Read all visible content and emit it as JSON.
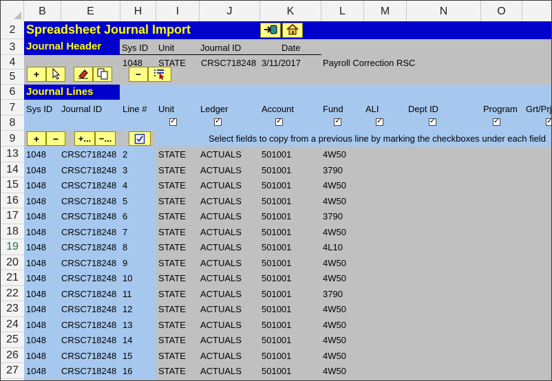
{
  "columns": [
    "B",
    "E",
    "H",
    "I",
    "J",
    "K",
    "L",
    "M",
    "N",
    "O"
  ],
  "title": "Spreadsheet Journal Import",
  "header": {
    "section_label": "Journal Header",
    "col_labels": {
      "sys_id": "Sys ID",
      "unit": "Unit",
      "journal_id": "Journal ID",
      "date": "Date"
    },
    "values": {
      "sys_id": "1048",
      "unit": "STATE",
      "journal_id": "CRSC718248",
      "date": "3/11/2017",
      "description": "Payroll Correction RSC"
    }
  },
  "lines_label": "Journal Lines",
  "line_cols": {
    "sys_id": "Sys ID",
    "journal_id": "Journal ID",
    "line": "Line #",
    "unit": "Unit",
    "ledger": "Ledger",
    "account": "Account",
    "fund": "Fund",
    "ali": "ALI",
    "dept": "Dept ID",
    "program": "Program",
    "grt": "Grt/Prj"
  },
  "select_hint": "Select fields to copy from a previous line by marking the checkboxes under each field",
  "row_numbers": {
    "title": "2",
    "hdr": "3",
    "hdrvals": "4",
    "tools": "5",
    "lines": "6",
    "linecols": "7",
    "checks": "8",
    "linetools": "9"
  },
  "lines": [
    {
      "row": "13",
      "sys": "1048",
      "jid": "CRSC718248",
      "line": "2",
      "unit": "STATE",
      "ledger": "ACTUALS",
      "account": "501001",
      "fund": "4W50"
    },
    {
      "row": "14",
      "sys": "1048",
      "jid": "CRSC718248",
      "line": "3",
      "unit": "STATE",
      "ledger": "ACTUALS",
      "account": "501001",
      "fund": "3790"
    },
    {
      "row": "15",
      "sys": "1048",
      "jid": "CRSC718248",
      "line": "4",
      "unit": "STATE",
      "ledger": "ACTUALS",
      "account": "501001",
      "fund": "4W50"
    },
    {
      "row": "16",
      "sys": "1048",
      "jid": "CRSC718248",
      "line": "5",
      "unit": "STATE",
      "ledger": "ACTUALS",
      "account": "501001",
      "fund": "4W50"
    },
    {
      "row": "17",
      "sys": "1048",
      "jid": "CRSC718248",
      "line": "6",
      "unit": "STATE",
      "ledger": "ACTUALS",
      "account": "501001",
      "fund": "3790"
    },
    {
      "row": "18",
      "sys": "1048",
      "jid": "CRSC718248",
      "line": "7",
      "unit": "STATE",
      "ledger": "ACTUALS",
      "account": "501001",
      "fund": "4W50"
    },
    {
      "row": "19",
      "sys": "1048",
      "jid": "CRSC718248",
      "line": "8",
      "unit": "STATE",
      "ledger": "ACTUALS",
      "account": "501001",
      "fund": "4L10"
    },
    {
      "row": "20",
      "sys": "1048",
      "jid": "CRSC718248",
      "line": "9",
      "unit": "STATE",
      "ledger": "ACTUALS",
      "account": "501001",
      "fund": "4W50"
    },
    {
      "row": "21",
      "sys": "1048",
      "jid": "CRSC718248",
      "line": "10",
      "unit": "STATE",
      "ledger": "ACTUALS",
      "account": "501001",
      "fund": "4W50"
    },
    {
      "row": "22",
      "sys": "1048",
      "jid": "CRSC718248",
      "line": "11",
      "unit": "STATE",
      "ledger": "ACTUALS",
      "account": "501001",
      "fund": "3790"
    },
    {
      "row": "23",
      "sys": "1048",
      "jid": "CRSC718248",
      "line": "12",
      "unit": "STATE",
      "ledger": "ACTUALS",
      "account": "501001",
      "fund": "4W50"
    },
    {
      "row": "24",
      "sys": "1048",
      "jid": "CRSC718248",
      "line": "13",
      "unit": "STATE",
      "ledger": "ACTUALS",
      "account": "501001",
      "fund": "4W50"
    },
    {
      "row": "25",
      "sys": "1048",
      "jid": "CRSC718248",
      "line": "14",
      "unit": "STATE",
      "ledger": "ACTUALS",
      "account": "501001",
      "fund": "4W50"
    },
    {
      "row": "26",
      "sys": "1048",
      "jid": "CRSC718248",
      "line": "15",
      "unit": "STATE",
      "ledger": "ACTUALS",
      "account": "501001",
      "fund": "4W50"
    },
    {
      "row": "27",
      "sys": "1048",
      "jid": "CRSC718248",
      "line": "16",
      "unit": "STATE",
      "ledger": "ACTUALS",
      "account": "501001",
      "fund": "4W50"
    }
  ],
  "buttons": {
    "add": "+",
    "remove": "−",
    "add_more": "+...",
    "remove_more": "−..."
  },
  "icons": [
    "import-icon",
    "home-icon",
    "pointer-icon",
    "eraser-icon",
    "copy-icon",
    "remove-icon",
    "list-select-icon",
    "checkbox-icon"
  ],
  "colors": {
    "title_band": "#0000cc",
    "title_text": "#ffff00",
    "light_band": "#a6c8ee",
    "grey": "#c0c0c0",
    "button": "#ffff88"
  }
}
